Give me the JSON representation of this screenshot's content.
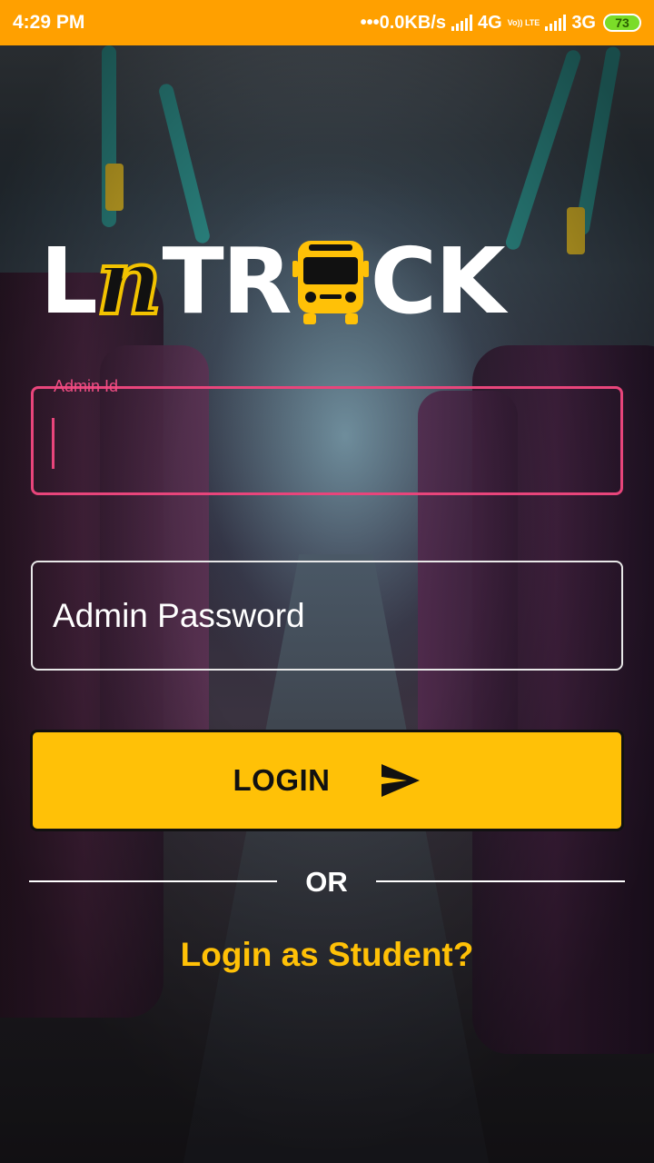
{
  "status_bar": {
    "time": "4:29 PM",
    "net_speed": "•••0.0KB/s",
    "network_1": "4G",
    "volte": "Vo)) LTE",
    "network_2": "3G",
    "battery": "73",
    "background_color": "#ffa000"
  },
  "logo": {
    "text_start": "L",
    "text_fancy": "n",
    "text_mid": "TR",
    "text_end": "CK",
    "bus_icon": "bus-icon"
  },
  "form": {
    "admin_id": {
      "label": "Admin Id",
      "value": "",
      "accent_color": "#e8457b"
    },
    "admin_password": {
      "placeholder": "Admin Password",
      "value": ""
    }
  },
  "login_button": {
    "label": "LOGIN",
    "icon": "send-icon",
    "color": "#ffc107"
  },
  "divider": {
    "label": "OR"
  },
  "student_link": {
    "label": "Login as Student?",
    "color": "#ffc107"
  }
}
